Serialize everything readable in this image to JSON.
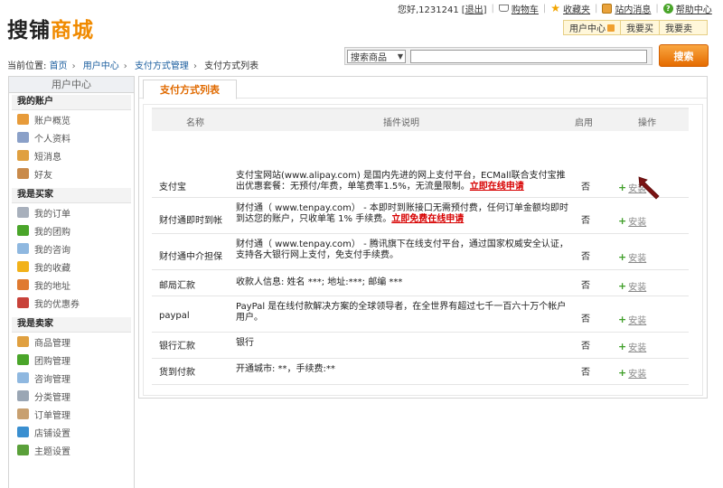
{
  "header": {
    "logo_part1": "搜铺",
    "logo_part2": "商城",
    "greeting": "您好,1231241",
    "logout": "[退出]",
    "links": [
      {
        "label": "购物车",
        "icon": "cart-icon"
      },
      {
        "label": "收藏夹",
        "icon": "star-icon"
      },
      {
        "label": "站内消息",
        "icon": "message-icon"
      },
      {
        "label": "帮助中心",
        "icon": "help-icon"
      }
    ],
    "user_menu": [
      "用户中心",
      "我要买",
      "我要卖"
    ]
  },
  "breadcrumb": {
    "prefix": "当前位置:",
    "items": [
      "首页",
      "用户中心",
      "支付方式管理"
    ],
    "current": "支付方式列表"
  },
  "search": {
    "category": "搜索商品",
    "value": "",
    "button": "搜索"
  },
  "sidebar": {
    "title": "用户中心",
    "sections": [
      {
        "heading": "我的账户",
        "items": [
          {
            "label": "账户概览",
            "icon": "home-icon",
            "color": "#e79b3a"
          },
          {
            "label": "个人资料",
            "icon": "profile-icon",
            "color": "#8aa0c8"
          },
          {
            "label": "短消息",
            "icon": "mail-icon",
            "color": "#e0a040"
          },
          {
            "label": "好友",
            "icon": "friends-icon",
            "color": "#c98a4a"
          }
        ]
      },
      {
        "heading": "我是买家",
        "items": [
          {
            "label": "我的订单",
            "icon": "order-icon",
            "color": "#a8b0bc"
          },
          {
            "label": "我的团购",
            "icon": "group-buy-icon",
            "color": "#4aa52a"
          },
          {
            "label": "我的咨询",
            "icon": "consult-icon",
            "color": "#8fb8e0"
          },
          {
            "label": "我的收藏",
            "icon": "favorite-icon",
            "color": "#f2b21a"
          },
          {
            "label": "我的地址",
            "icon": "address-icon",
            "color": "#e07a30"
          },
          {
            "label": "我的优惠券",
            "icon": "coupon-icon",
            "color": "#c8423a"
          }
        ]
      },
      {
        "heading": "我是卖家",
        "items": [
          {
            "label": "商品管理",
            "icon": "goods-icon",
            "color": "#e0a040"
          },
          {
            "label": "团购管理",
            "icon": "group-manage-icon",
            "color": "#4aa52a"
          },
          {
            "label": "咨询管理",
            "icon": "consult-manage-icon",
            "color": "#8fb8e0"
          },
          {
            "label": "分类管理",
            "icon": "category-icon",
            "color": "#9aa6b4"
          },
          {
            "label": "订单管理",
            "icon": "order-manage-icon",
            "color": "#c8a070"
          },
          {
            "label": "店铺设置",
            "icon": "store-icon",
            "color": "#3a8fd0"
          },
          {
            "label": "主题设置",
            "icon": "theme-icon",
            "color": "#5aa03a"
          }
        ]
      }
    ]
  },
  "main": {
    "tab": "支付方式列表",
    "columns": [
      "名称",
      "插件说明",
      "启用",
      "操作"
    ],
    "rows": [
      {
        "name": "支付宝",
        "desc": "支付宝网站(www.alipay.com) 是国内先进的网上支付平台，ECMall联合支付宝推出优惠套餐：无预付/年费，单笔费率1.5%，无流量限制。",
        "link": "立即在线申请",
        "enabled": "否",
        "action": "安装"
      },
      {
        "name": "财付通即时到帐",
        "desc": "财付通（ www.tenpay.com） - 本即时到账接口无需预付费，任何订单金额均即时到达您的账户，只收单笔  1% 手续费。",
        "link": "立即免费在线申请",
        "enabled": "否",
        "action": "安装"
      },
      {
        "name": "财付通中介担保",
        "desc": "财付通（ www.tenpay.com） - 腾讯旗下在线支付平台，通过国家权威安全认证，支持各大银行网上支付，免支付手续费。",
        "link": "",
        "enabled": "否",
        "action": "安装"
      },
      {
        "name": "邮局汇款",
        "desc": "收款人信息: 姓名 ***; 地址:***; 邮编  ***",
        "link": "",
        "enabled": "否",
        "action": "安装"
      },
      {
        "name": "paypal",
        "desc": "PayPal 是在线付款解决方案的全球领导者，在全世界有超过七千一百六十万个帐户用户。",
        "link": "",
        "enabled": "否",
        "action": "安装"
      },
      {
        "name": "银行汇款",
        "desc": "银行",
        "link": "",
        "enabled": "否",
        "action": "安装"
      },
      {
        "name": "货到付款",
        "desc": "开通城市: **，手续费:**",
        "link": "",
        "enabled": "否",
        "action": "安装"
      }
    ]
  }
}
